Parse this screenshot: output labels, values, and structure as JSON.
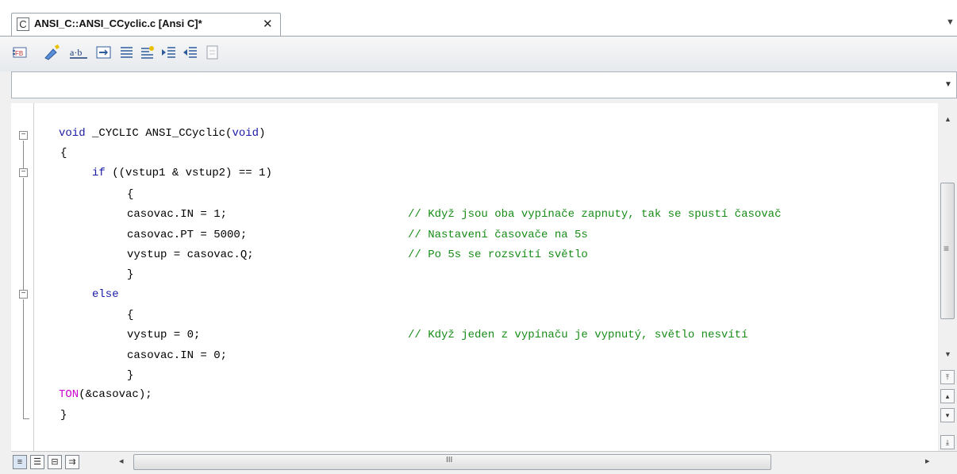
{
  "tab": {
    "icon": "c-source-file-icon",
    "icon_text": "C",
    "title": "ANSI_C::ANSI_CCyclic.c [Ansi C]*",
    "close": "✕",
    "menu": "▼"
  },
  "toolbar": {
    "buttons": [
      "function-block-icon",
      "insert-icon",
      "find-replace-icon",
      "toggle-view-icon",
      "align-icon",
      "comment-icon",
      "indent-icon",
      "outdent-icon",
      "blank-page-icon"
    ]
  },
  "combo": {
    "value": "",
    "arrow": "▼"
  },
  "code": {
    "l1_kw1": "void",
    "l1_mid": " _CYCLIC ANSI_CCyclic(",
    "l1_kw2": "void",
    "l1_end": ")",
    "l2": "{",
    "l3_kw": "if",
    "l3_rest": " ((vstup1 & vstup2) == 1)",
    "l4": "{",
    "l5_code": "casovac.IN = 1;",
    "l5_cm": "// Když jsou oba vypínače zapnuty, tak se spustí časovač",
    "l6_code": "casovac.PT = 5000;",
    "l6_cm": "// Nastavení časovače na 5s",
    "l7_code": "vystup = casovac.Q;",
    "l7_cm": "// Po 5s se rozsvítí světlo",
    "l8": "}",
    "l9_kw": "else",
    "l10": "{",
    "l11_code": "vystup = 0;",
    "l11_cm": "// Když jeden z vypínaču je vypnutý, světlo nesvítí",
    "l12_code": "casovac.IN = 0;",
    "l13": "}",
    "l14_fn": "TON",
    "l14_rest": "(&casovac);",
    "l15": "}"
  },
  "scroll": {
    "up": "▲",
    "down": "▼",
    "top": "⤒",
    "prev": "▴",
    "next": "▾",
    "bottom": "⤓",
    "left": "◂",
    "right": "▸",
    "grip": "III",
    "vgrip": "≡"
  },
  "bottom_views": [
    "≡",
    "☰",
    "⊟",
    "⇉"
  ]
}
